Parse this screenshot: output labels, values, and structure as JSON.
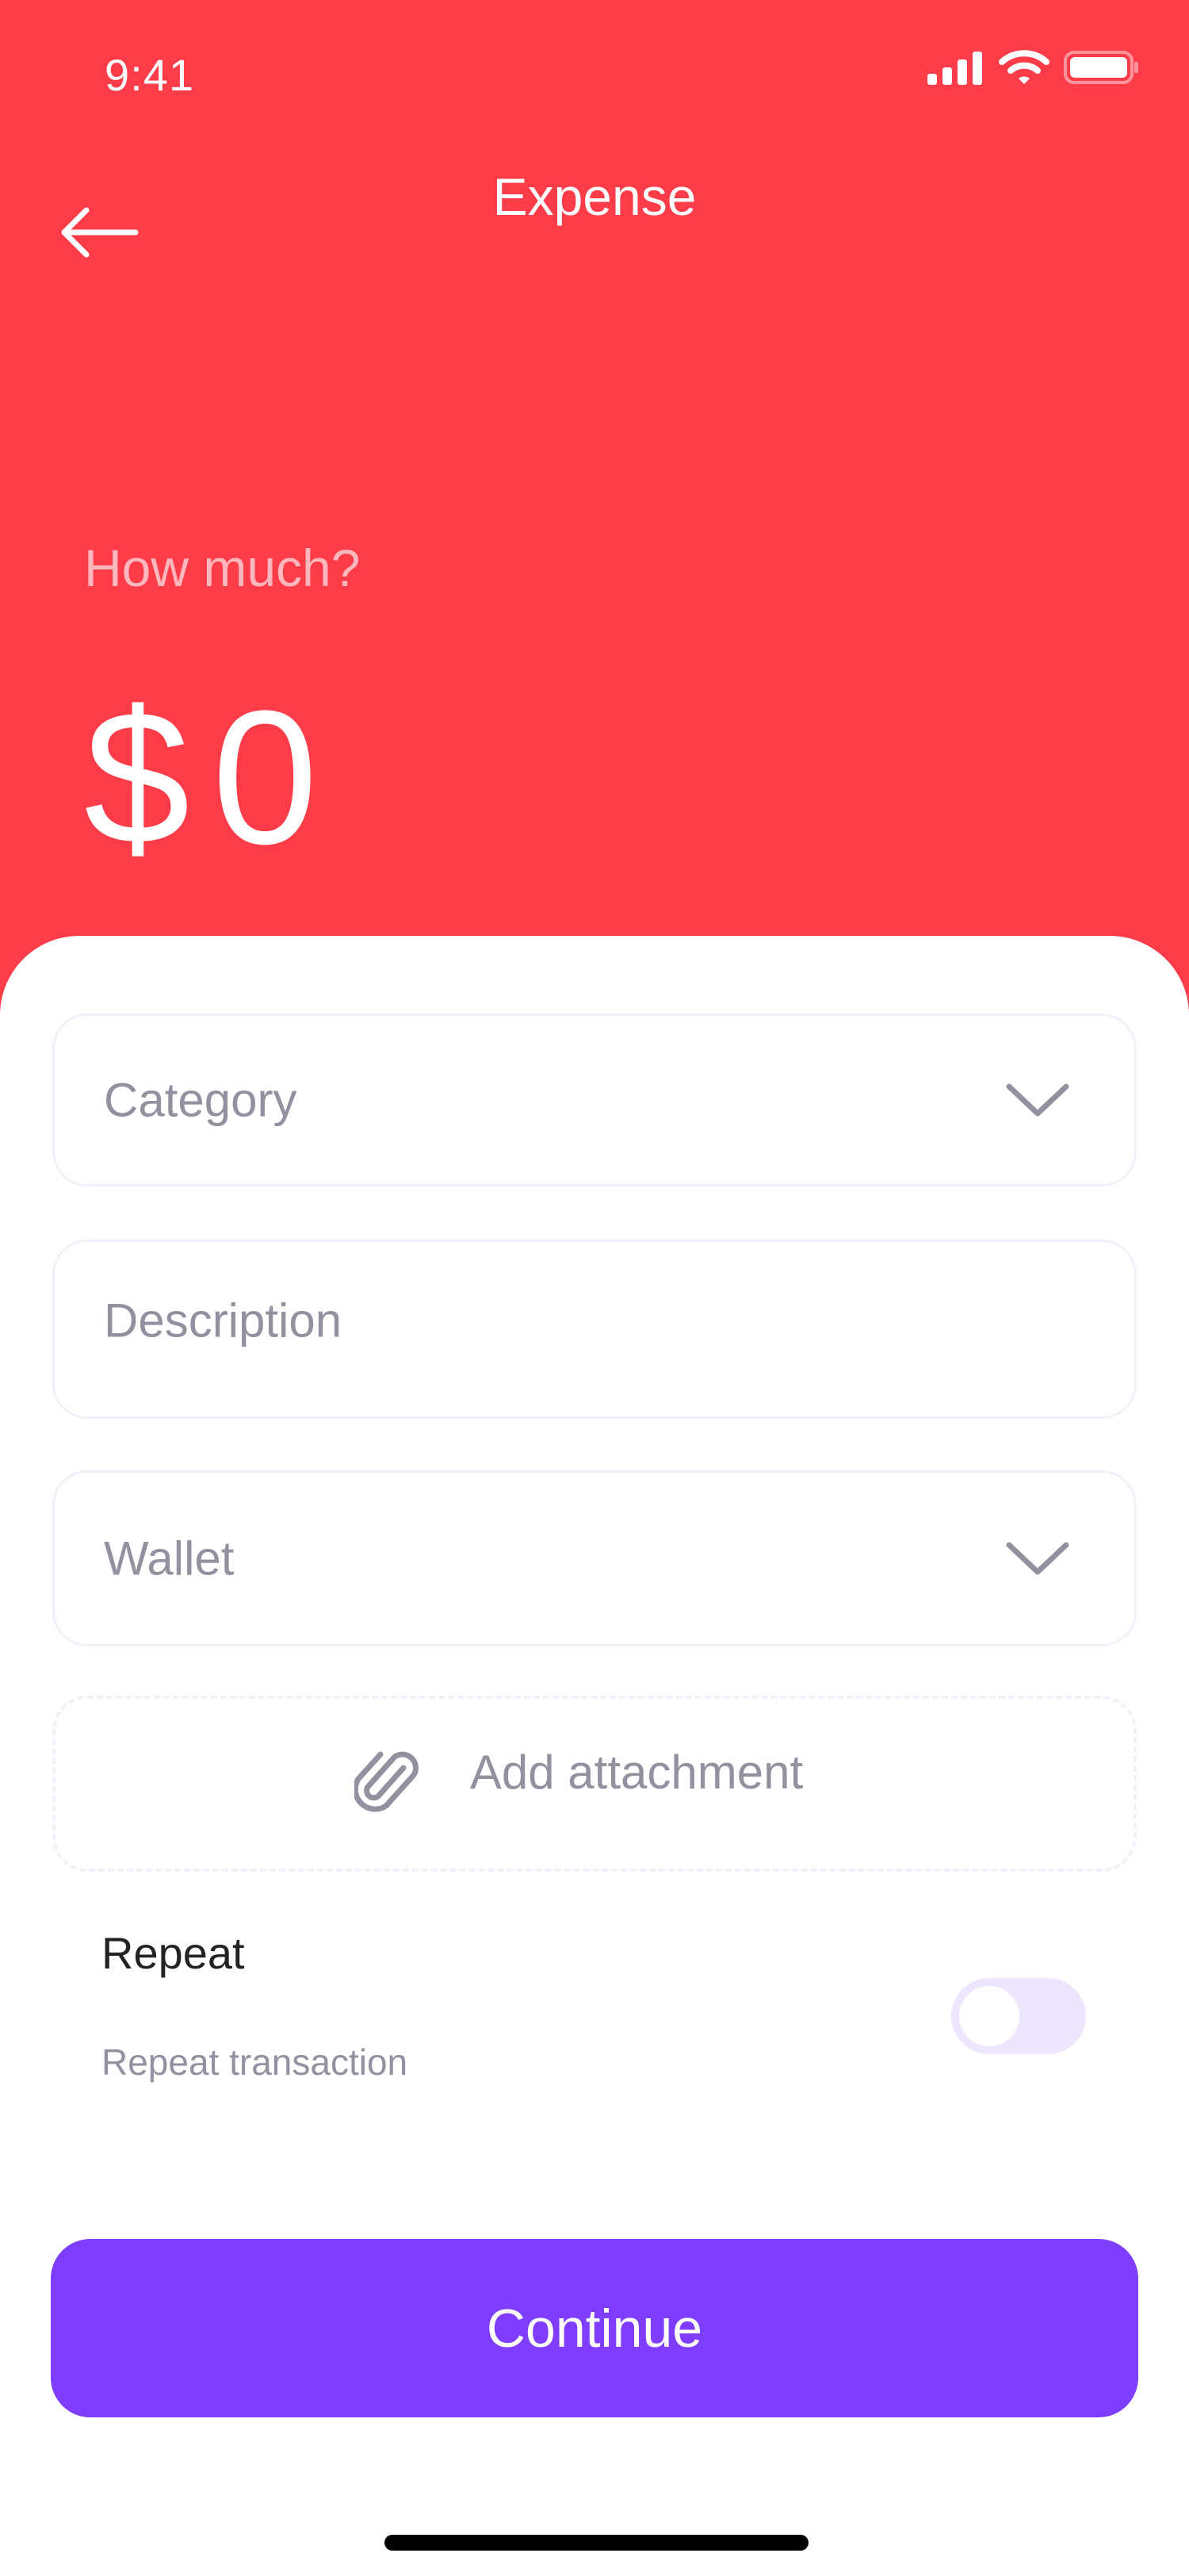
{
  "status_bar": {
    "time": "9:41",
    "icons": [
      "cellular-signal-icon",
      "wifi-icon",
      "battery-icon"
    ]
  },
  "header": {
    "title": "Expense",
    "back_icon": "arrow-left-icon"
  },
  "amount": {
    "label": "How much?",
    "currency": "$",
    "value": "0"
  },
  "form": {
    "category": {
      "placeholder": "Category",
      "icon": "chevron-down-icon"
    },
    "description": {
      "placeholder": "Description"
    },
    "wallet": {
      "placeholder": "Wallet",
      "icon": "chevron-down-icon"
    },
    "attachment": {
      "label": "Add attachment",
      "icon": "paperclip-icon"
    },
    "repeat": {
      "title": "Repeat",
      "subtitle": "Repeat transaction",
      "enabled": false
    }
  },
  "actions": {
    "continue_label": "Continue"
  },
  "colors": {
    "expense_red": "#FD3C4A",
    "primary_violet": "#7F3DFF",
    "light_violet": "#EEE5FF",
    "placeholder_gray": "#91919F",
    "border_gray": "#F1F1FA"
  }
}
